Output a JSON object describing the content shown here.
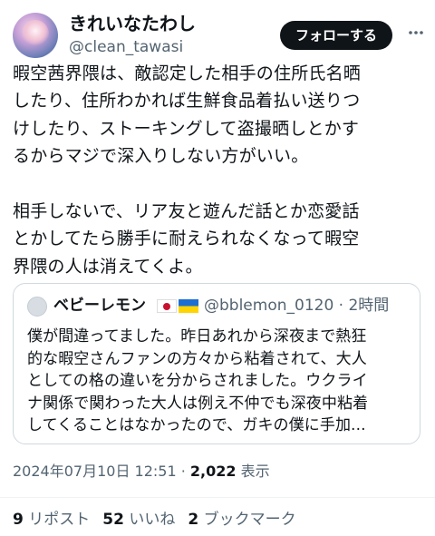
{
  "author": {
    "display_name": "きれいなたわし",
    "handle": "@clean_tawasi",
    "follow_label": "フォローする",
    "more_icon": "more-dots-icon"
  },
  "tweet": {
    "text": "暇空茜界隈は、敵認定した相手の住所氏名晒\nしたり、住所わかれば生鮮食品着払い送りつ\nけしたり、ストーキングして盗撮晒しとかす\nるからマジで深入りしない方がいい。\n\n相手しないで、リア友と遊んだ話とか恋愛話\nとかしてたら勝手に耐えられなくなって暇空\n界隈の人は消えてくよ。"
  },
  "quote": {
    "display_name": "ベビーレモン",
    "flags": [
      "japan-flag-icon",
      "ukraine-flag-icon"
    ],
    "handle_time": "@bblemon_0120 · 2時間",
    "text": "僕が間違ってました。昨日あれから深夜まで熱狂\n的な暇空さんファンの方々から粘着されて、大人\nとしての格の違いを分からされました。ウクライ\nナ関係で関わった大人は例え不仲でも深夜中粘着\nしてくることはなかったので、ガキの僕に手加..."
  },
  "meta": {
    "timestamp": "2024年07月10日 12:51 · ",
    "views_count": "2,022",
    "views_label": " 表示"
  },
  "stats": {
    "reposts_count": "9",
    "reposts_label": " リポスト",
    "likes_count": "52",
    "likes_label": " いいね",
    "bookmarks_count": "2",
    "bookmarks_label": " ブックマーク"
  }
}
